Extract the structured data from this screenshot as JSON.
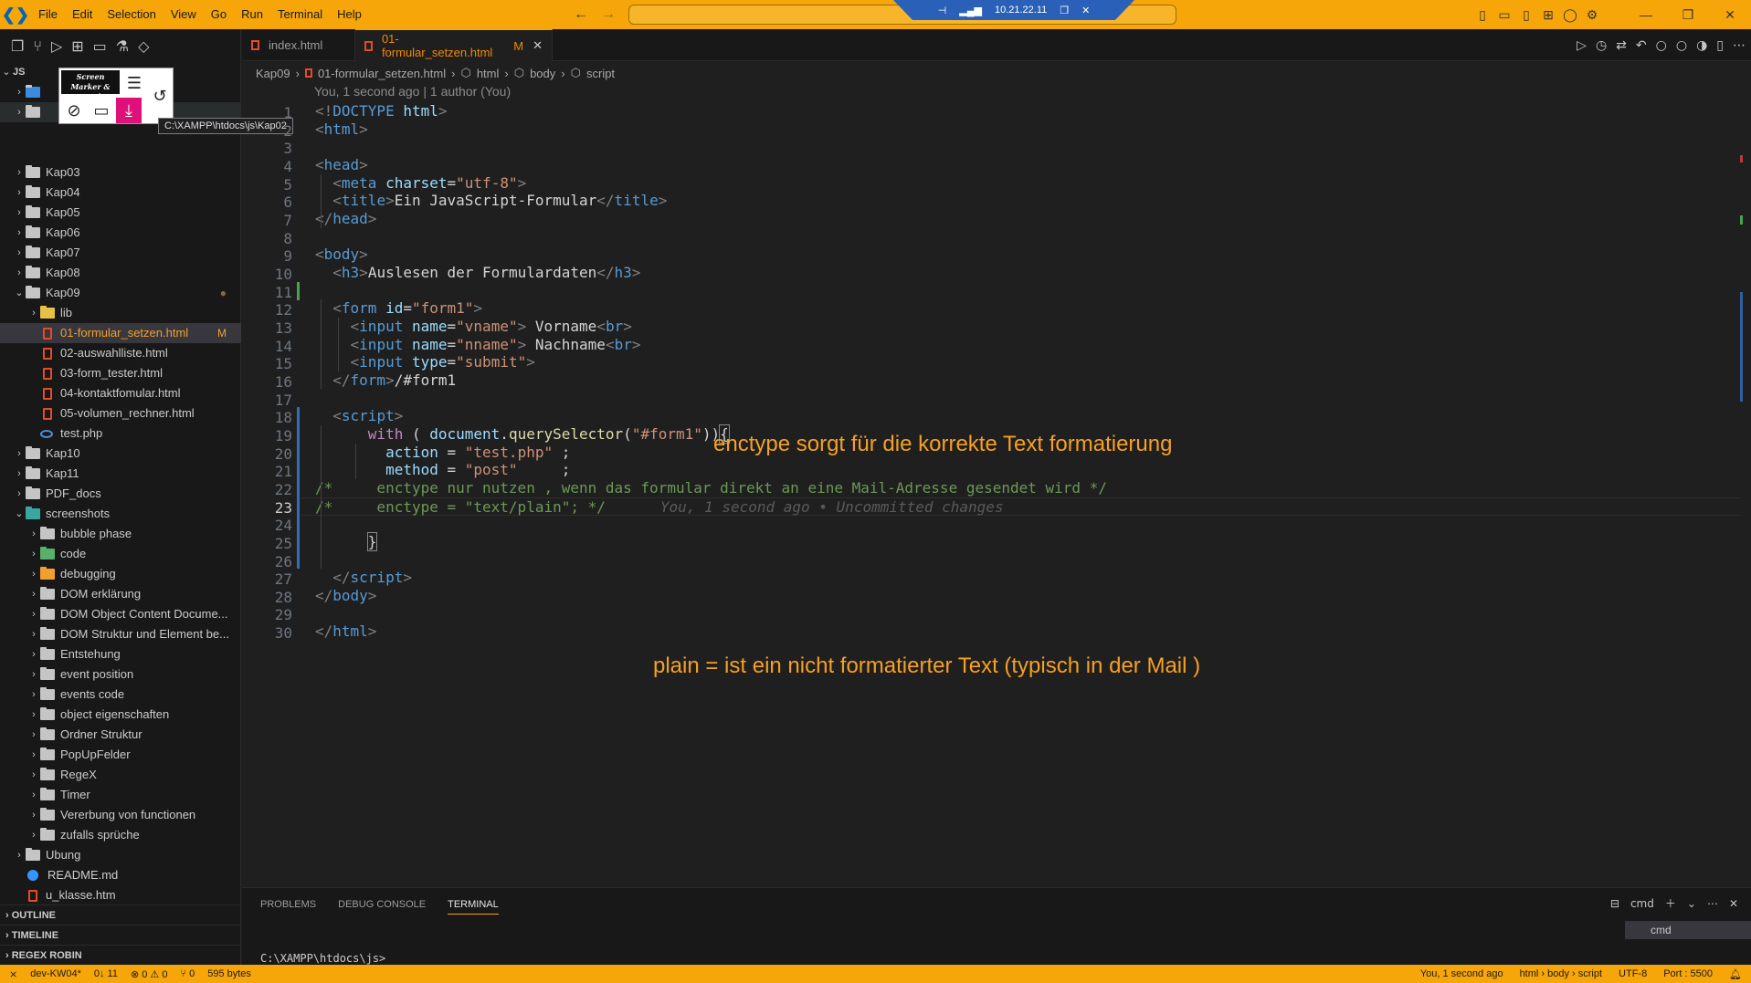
{
  "menu": [
    "File",
    "Edit",
    "Selection",
    "View",
    "Go",
    "Run",
    "Terminal",
    "Help"
  ],
  "remote": {
    "ip": "10.21.22.11"
  },
  "sidebar": {
    "root": "JS",
    "tooltip": "C:\\XAMPP\\htdocs\\js\\Kap02",
    "marker_title": "Screen Marker & Recorder",
    "tree": [
      {
        "label": "Kap03",
        "level": 0,
        "type": "folder"
      },
      {
        "label": "Kap04",
        "level": 0,
        "type": "folder"
      },
      {
        "label": "Kap05",
        "level": 0,
        "type": "folder"
      },
      {
        "label": "Kap06",
        "level": 0,
        "type": "folder"
      },
      {
        "label": "Kap07",
        "level": 0,
        "type": "folder"
      },
      {
        "label": "Kap08",
        "level": 0,
        "type": "folder"
      },
      {
        "label": "Kap09",
        "level": 0,
        "type": "folder-open"
      },
      {
        "label": "lib",
        "level": 1,
        "type": "folder-y"
      },
      {
        "label": "01-formular_setzen.html",
        "level": 1,
        "type": "html",
        "badge": "M"
      },
      {
        "label": "02-auswahlliste.html",
        "level": 1,
        "type": "html"
      },
      {
        "label": "03-form_tester.html",
        "level": 1,
        "type": "html"
      },
      {
        "label": "04-kontaktfomular.html",
        "level": 1,
        "type": "html"
      },
      {
        "label": "05-volumen_rechner.html",
        "level": 1,
        "type": "html"
      },
      {
        "label": "test.php",
        "level": 1,
        "type": "php"
      },
      {
        "label": "Kap10",
        "level": 0,
        "type": "folder"
      },
      {
        "label": "Kap11",
        "level": 0,
        "type": "folder"
      },
      {
        "label": "PDF_docs",
        "level": 0,
        "type": "folder"
      },
      {
        "label": "screenshots",
        "level": 0,
        "type": "folder-t"
      },
      {
        "label": "bubble phase",
        "level": 1,
        "type": "folder"
      },
      {
        "label": "code",
        "level": 1,
        "type": "folder-g"
      },
      {
        "label": "debugging",
        "level": 1,
        "type": "folder-o"
      },
      {
        "label": "DOM erklärung",
        "level": 1,
        "type": "folder"
      },
      {
        "label": "DOM Object Content Docume...",
        "level": 1,
        "type": "folder"
      },
      {
        "label": "DOM Struktur und Element be...",
        "level": 1,
        "type": "folder"
      },
      {
        "label": "Entstehung",
        "level": 1,
        "type": "folder"
      },
      {
        "label": "event position",
        "level": 1,
        "type": "folder"
      },
      {
        "label": "events code",
        "level": 1,
        "type": "folder"
      },
      {
        "label": "object eigenschaften",
        "level": 1,
        "type": "folder"
      },
      {
        "label": "Ordner Struktur",
        "level": 1,
        "type": "folder"
      },
      {
        "label": "PopUpFelder",
        "level": 1,
        "type": "folder"
      },
      {
        "label": "RegeX",
        "level": 1,
        "type": "folder"
      },
      {
        "label": "Timer",
        "level": 1,
        "type": "folder"
      },
      {
        "label": "Vererbung von functionen",
        "level": 1,
        "type": "folder"
      },
      {
        "label": "zufalls sprüche",
        "level": 1,
        "type": "folder"
      },
      {
        "label": "Ubung",
        "level": 0,
        "type": "folder"
      },
      {
        "label": "README.md",
        "level": 0,
        "type": "info"
      },
      {
        "label": "u_klasse.htm",
        "level": 0,
        "type": "html"
      }
    ],
    "sections": [
      "OUTLINE",
      "TIMELINE",
      "REGEX ROBIN"
    ]
  },
  "tabs": [
    {
      "label": "index.html",
      "active": false
    },
    {
      "label": "01-formular_setzen.html",
      "active": true,
      "badge": "M"
    }
  ],
  "breadcrumb": [
    "Kap09",
    "01-formular_setzen.html",
    "html",
    "body",
    "script"
  ],
  "blame": "You, 1 second ago | 1 author (You)",
  "code": {
    "current_line": 23,
    "ghost": "You, 1 second ago • Uncommitted changes",
    "lines": [
      [
        [
          "t-br",
          "<!"
        ],
        [
          "t-tag",
          "DOCTYPE"
        ],
        [
          "t-pl",
          " "
        ],
        [
          "t-at",
          "html"
        ],
        [
          "t-br",
          ">"
        ]
      ],
      [
        [
          "t-br",
          "<"
        ],
        [
          "t-tag",
          "html"
        ],
        [
          "t-br",
          ">"
        ]
      ],
      [],
      [
        [
          "t-br",
          "<"
        ],
        [
          "t-tag",
          "head"
        ],
        [
          "t-br",
          ">"
        ]
      ],
      [
        [
          "t-pl",
          "  "
        ],
        [
          "t-br",
          "<"
        ],
        [
          "t-tag",
          "meta"
        ],
        [
          "t-pl",
          " "
        ],
        [
          "t-at",
          "charset"
        ],
        [
          "t-pl",
          "="
        ],
        [
          "t-st",
          "\"utf-8\""
        ],
        [
          "t-br",
          ">"
        ]
      ],
      [
        [
          "t-pl",
          "  "
        ],
        [
          "t-br",
          "<"
        ],
        [
          "t-tag",
          "title"
        ],
        [
          "t-br",
          ">"
        ],
        [
          "t-tx",
          "Ein JavaScript-Formular"
        ],
        [
          "t-br",
          "</"
        ],
        [
          "t-tag",
          "title"
        ],
        [
          "t-br",
          ">"
        ]
      ],
      [
        [
          "t-br",
          "</"
        ],
        [
          "t-tag",
          "head"
        ],
        [
          "t-br",
          ">"
        ]
      ],
      [],
      [
        [
          "t-br",
          "<"
        ],
        [
          "t-tag",
          "body"
        ],
        [
          "t-br",
          ">"
        ]
      ],
      [
        [
          "t-pl",
          "  "
        ],
        [
          "t-br",
          "<"
        ],
        [
          "t-tag",
          "h3"
        ],
        [
          "t-br",
          ">"
        ],
        [
          "t-tx",
          "Auslesen der Formulardaten"
        ],
        [
          "t-br",
          "</"
        ],
        [
          "t-tag",
          "h3"
        ],
        [
          "t-br",
          ">"
        ]
      ],
      [],
      [
        [
          "t-pl",
          "  "
        ],
        [
          "t-br",
          "<"
        ],
        [
          "t-tag",
          "form"
        ],
        [
          "t-pl",
          " "
        ],
        [
          "t-at",
          "id"
        ],
        [
          "t-pl",
          "="
        ],
        [
          "t-st",
          "\"form1\""
        ],
        [
          "t-br",
          ">"
        ]
      ],
      [
        [
          "t-pl",
          "    "
        ],
        [
          "t-br",
          "<"
        ],
        [
          "t-tag",
          "input"
        ],
        [
          "t-pl",
          " "
        ],
        [
          "t-at",
          "name"
        ],
        [
          "t-pl",
          "="
        ],
        [
          "t-st",
          "\"vname\""
        ],
        [
          "t-br",
          ">"
        ],
        [
          "t-tx",
          " Vorname"
        ],
        [
          "t-br",
          "<"
        ],
        [
          "t-tag",
          "br"
        ],
        [
          "t-br",
          ">"
        ]
      ],
      [
        [
          "t-pl",
          "    "
        ],
        [
          "t-br",
          "<"
        ],
        [
          "t-tag",
          "input"
        ],
        [
          "t-pl",
          " "
        ],
        [
          "t-at",
          "name"
        ],
        [
          "t-pl",
          "="
        ],
        [
          "t-st",
          "\"nname\""
        ],
        [
          "t-br",
          ">"
        ],
        [
          "t-tx",
          " Nachname"
        ],
        [
          "t-br",
          "<"
        ],
        [
          "t-tag",
          "br"
        ],
        [
          "t-br",
          ">"
        ]
      ],
      [
        [
          "t-pl",
          "    "
        ],
        [
          "t-br",
          "<"
        ],
        [
          "t-tag",
          "input"
        ],
        [
          "t-pl",
          " "
        ],
        [
          "t-at",
          "type"
        ],
        [
          "t-pl",
          "="
        ],
        [
          "t-st",
          "\"submit\""
        ],
        [
          "t-br",
          ">"
        ]
      ],
      [
        [
          "t-pl",
          "  "
        ],
        [
          "t-br",
          "</"
        ],
        [
          "t-tag",
          "form"
        ],
        [
          "t-br",
          ">"
        ],
        [
          "t-tx",
          "/#form1"
        ]
      ],
      [],
      [
        [
          "t-pl",
          "  "
        ],
        [
          "t-br",
          "<"
        ],
        [
          "t-tag",
          "script"
        ],
        [
          "t-br",
          ">"
        ]
      ],
      [
        [
          "t-pl",
          "      "
        ],
        [
          "t-kw",
          "with"
        ],
        [
          "t-pl",
          " ( "
        ],
        [
          "t-id",
          "document"
        ],
        [
          "t-pl",
          "."
        ],
        [
          "t-fn",
          "querySelector"
        ],
        [
          "t-pl",
          "("
        ],
        [
          "t-st",
          "\"#form1\""
        ],
        [
          "t-pl",
          "))"
        ],
        [
          "t-pl bracket",
          "{"
        ]
      ],
      [
        [
          "t-pl",
          "        "
        ],
        [
          "t-id",
          "action"
        ],
        [
          "t-pl",
          " = "
        ],
        [
          "t-st",
          "\"test.php\""
        ],
        [
          "t-pl",
          " ;"
        ]
      ],
      [
        [
          "t-pl",
          "        "
        ],
        [
          "t-id",
          "method"
        ],
        [
          "t-pl",
          " = "
        ],
        [
          "t-st",
          "\"post\""
        ],
        [
          "t-pl",
          "     ;"
        ]
      ],
      [
        [
          "t-cm",
          "/*     enctype nur nutzen , wenn das formular direkt an eine Mail-Adresse gesendet wird */"
        ]
      ],
      [
        [
          "t-cm",
          "/*     enctype = \"text/plain\"; */"
        ]
      ],
      [],
      [
        [
          "t-pl",
          "      "
        ],
        [
          "t-pl bracket",
          "}"
        ]
      ],
      [],
      [
        [
          "t-pl",
          "  "
        ],
        [
          "t-br",
          "</"
        ],
        [
          "t-tag",
          "script"
        ],
        [
          "t-br",
          ">"
        ]
      ],
      [
        [
          "t-br",
          "</"
        ],
        [
          "t-tag",
          "body"
        ],
        [
          "t-br",
          ">"
        ]
      ],
      [],
      [
        [
          "t-br",
          "</"
        ],
        [
          "t-tag",
          "html"
        ],
        [
          "t-br",
          ">"
        ]
      ]
    ]
  },
  "annotations": {
    "note1": "enctype sorgt für die korrekte Text formatierung",
    "note2": "plain = ist ein nicht formatierter Text (typisch in der Mail )"
  },
  "panel": {
    "tabs": [
      "PROBLEMS",
      "DEBUG CONSOLE",
      "TERMINAL"
    ],
    "active_tab": "TERMINAL",
    "terminal_name": "cmd",
    "prompt": "C:\\XAMPP\\htdocs\\js>"
  },
  "status": {
    "branch": "dev-KW04*",
    "sync": "0↓ 11",
    "problems": "⊗ 0 ⚠ 0",
    "ports": "⑂ 0",
    "size": "595 bytes",
    "blame": "You, 1 second ago",
    "path": "html › body › script",
    "encoding": "UTF-8",
    "port": "Port : 5500"
  },
  "colors": {
    "accent": "#f6a609",
    "annotation": "#f6a022"
  }
}
